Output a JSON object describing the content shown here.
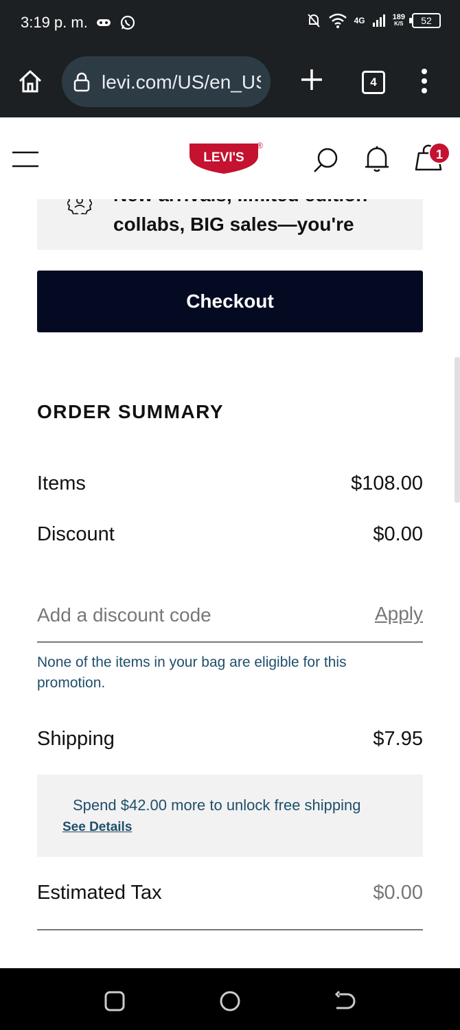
{
  "status_bar": {
    "time": "3:19 p. m.",
    "network": "4G",
    "speed": "189",
    "speed_unit": "K/S",
    "battery": "52"
  },
  "browser": {
    "url": "levi.com/US/en_US",
    "tab_count": "4"
  },
  "header": {
    "logo_text": "LEVI'S",
    "bag_count": "1"
  },
  "promo": {
    "line1": "New arrivals, limited edition",
    "line2": "collabs, BIG sales—you're"
  },
  "checkout_label": "Checkout",
  "order_summary": {
    "title": "ORDER SUMMARY",
    "items_label": "Items",
    "items_value": "$108.00",
    "discount_label": "Discount",
    "discount_value": "$0.00",
    "discount_placeholder": "Add a discount code",
    "apply_label": "Apply",
    "eligibility_message": "None of the items in your bag are eligible for this promotion.",
    "shipping_label": "Shipping",
    "shipping_value": "$7.95",
    "free_shipping_message": "Spend $42.00 more to unlock free shipping",
    "see_details": "See Details",
    "tax_label": "Estimated Tax",
    "tax_value": "$0.00"
  },
  "colors": {
    "checkout_bg": "#040a22",
    "brand_red": "#c41230",
    "info_text": "#1f4e6b",
    "chrome_bg": "#1c2023"
  }
}
